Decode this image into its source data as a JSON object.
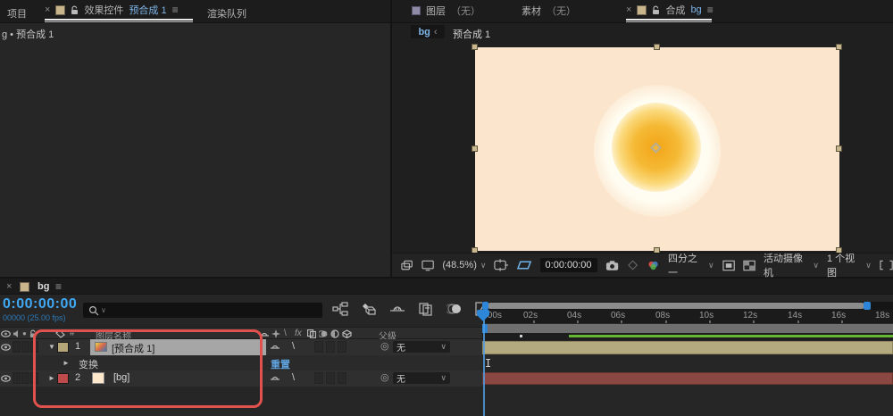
{
  "glyphs": {
    "close": "×",
    "menu": "≡",
    "chevron": "∨",
    "open": "▼",
    "closed": "►",
    "back": "‹",
    "pickwhip": "◎",
    "quality": "\\",
    "fx": "fx",
    "hash": "#",
    "solo": "●",
    "ibeam": "I"
  },
  "left_panel": {
    "tab_project": "项目",
    "tab_effect_controls": "效果控件",
    "tab_effect_controls_comp": "预合成 1",
    "tab_render_queue": "渲染队列",
    "breadcrumb": "g • 预合成 1"
  },
  "right_panel": {
    "tab_layer": "图层",
    "tab_layer_none": "（无）",
    "tab_footage": "素材",
    "tab_footage_none": "（无）",
    "tab_comp": "合成",
    "tab_comp_name": "bg",
    "nav_current": "bg",
    "nav_parent": "预合成 1"
  },
  "viewer_toolbar": {
    "zoom": "(48.5%)",
    "time": "0:00:00:00",
    "resolution": "四分之一",
    "camera": "活动摄像机",
    "views": "1 个视图"
  },
  "timeline": {
    "tab": "bg",
    "time_display": "0:00:00:00",
    "frame_display": "00000 (25.00 fps)",
    "columns": {
      "layer_name": "图层名称",
      "parent": "父级"
    },
    "layer1": {
      "index": "1",
      "name": "[预合成 1]",
      "parent": "无"
    },
    "transform_group": {
      "label": "变换",
      "reset": "重置"
    },
    "layer2": {
      "index": "2",
      "name": "[bg]",
      "parent": "无"
    },
    "ruler": [
      ":00s",
      "02s",
      "04s",
      "06s",
      "08s",
      "10s",
      "12s",
      "14s",
      "16s",
      "18s"
    ]
  },
  "colors": {
    "accent_blue": "#3fa9f5",
    "tab_link_blue": "#7eb4e6",
    "label_tan": "#b5a67a",
    "label_red": "#bf4a4c",
    "comp_background": "#fbe5cc",
    "annotation_red": "#e1514d",
    "preview_green": "#64b633",
    "layer1_bar": "#b4aa80",
    "layer2_bar": "#8b4842",
    "reset_link_blue": "#5ea0da"
  }
}
